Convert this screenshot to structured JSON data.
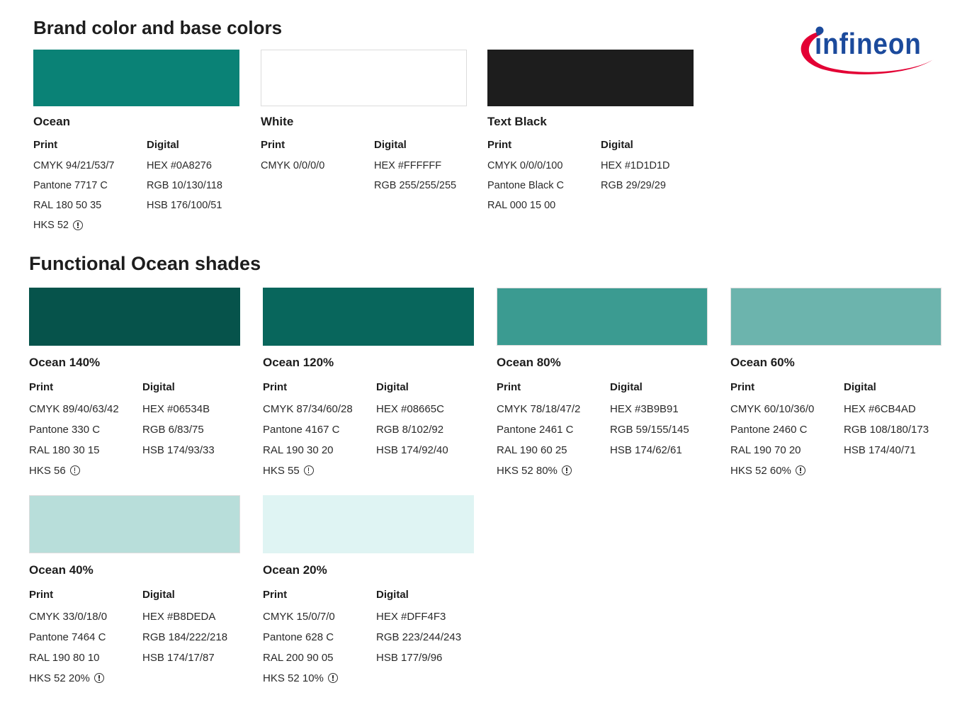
{
  "brand_section": {
    "title": "Brand color and base colors",
    "cards": [
      {
        "name": "Ocean",
        "color": "#0A8276",
        "print": [
          "CMYK 94/21/53/7",
          "Pantone 7717 C",
          "RAL 180 50 35",
          "HKS 52"
        ],
        "digital": [
          "HEX #0A8276",
          "RGB 10/130/118",
          "HSB 176/100/51"
        ]
      },
      {
        "name": "White",
        "color": "#FFFFFF",
        "print": [
          "CMYK 0/0/0/0"
        ],
        "digital": [
          "HEX #FFFFFF",
          "RGB 255/255/255"
        ]
      },
      {
        "name": "Text Black",
        "color": "#1D1D1D",
        "print": [
          "CMYK 0/0/0/100",
          "Pantone Black C",
          "RAL 000 15 00"
        ],
        "digital": [
          "HEX #1D1D1D",
          "RGB 29/29/29"
        ]
      }
    ]
  },
  "shades_section": {
    "title": "Functional Ocean shades",
    "cards": [
      {
        "name": "Ocean 140%",
        "color": "#06534B",
        "print": [
          "CMYK 89/40/63/42",
          "Pantone 330 C",
          "RAL 180 30 15",
          "HKS 56"
        ],
        "digital": [
          "HEX #06534B",
          "RGB 6/83/75",
          "HSB 174/93/33"
        ]
      },
      {
        "name": "Ocean 120%",
        "color": "#08665C",
        "print": [
          "CMYK 87/34/60/28",
          "Pantone 4167 C",
          "RAL 190 30 20",
          "HKS 55"
        ],
        "digital": [
          "HEX #08665C",
          "RGB 8/102/92",
          "HSB 174/92/40"
        ]
      },
      {
        "name": "Ocean 80%",
        "color": "#3B9B91",
        "print": [
          "CMYK 78/18/47/2",
          "Pantone 2461 C",
          "RAL 190 60 25",
          "HKS 52 80%"
        ],
        "digital": [
          "HEX #3B9B91",
          "RGB 59/155/145",
          "HSB 174/62/61"
        ]
      },
      {
        "name": "Ocean 60%",
        "color": "#6CB4AD",
        "print": [
          "CMYK 60/10/36/0",
          "Pantone 2460 C",
          "RAL 190 70 20",
          "HKS 52 60%"
        ],
        "digital": [
          "HEX #6CB4AD",
          "RGB 108/180/173",
          "HSB 174/40/71"
        ]
      },
      {
        "name": "Ocean 40%",
        "color": "#B8DEDA",
        "print": [
          "CMYK 33/0/18/0",
          "Pantone 7464 C",
          "RAL 190 80 10",
          "HKS 52 20%"
        ],
        "digital": [
          "HEX #B8DEDA",
          "RGB 184/222/218",
          "HSB 174/17/87"
        ]
      },
      {
        "name": "Ocean 20%",
        "color": "#DFF4F3",
        "print": [
          "CMYK 15/0/7/0",
          "Pantone 628 C",
          "RAL 200 90 05",
          "HKS 52 10%"
        ],
        "digital": [
          "HEX #DFF4F3",
          "RGB 223/244/243",
          "HSB 177/9/96"
        ]
      }
    ]
  },
  "labels": {
    "print": "Print",
    "digital": "Digital"
  },
  "logo": {
    "text": "infineon",
    "word_color": "#1B4A9C",
    "swoosh_color": "#E30034",
    "icon": "infineon-logo"
  }
}
